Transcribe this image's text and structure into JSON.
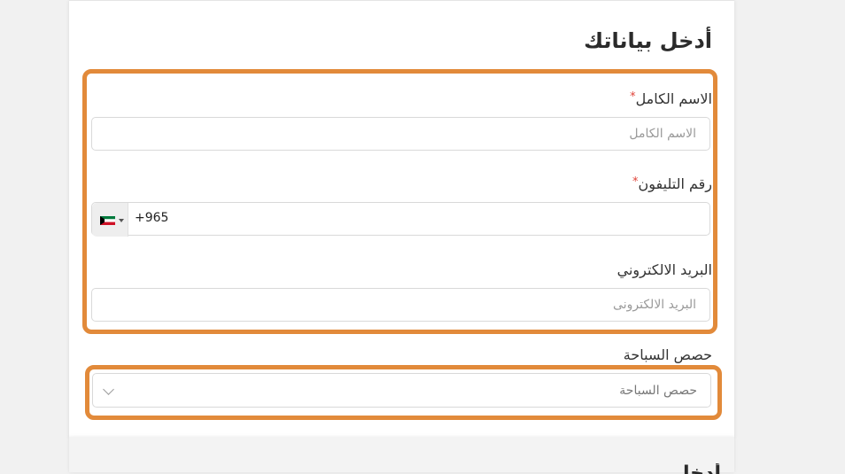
{
  "form": {
    "heading": "أدخل بياناتك",
    "next_heading_partial": "أدخل",
    "full_name": {
      "label": "الاسم الكامل",
      "required_mark": "*",
      "placeholder": "الاسم الكامل"
    },
    "phone": {
      "label": "رقم التليفون",
      "required_mark": "*",
      "dial_code": "+965",
      "country_icon": "kuwait-flag-icon"
    },
    "email": {
      "label": "البريد الالكتروني",
      "placeholder": "البريد الالكترونى"
    },
    "swimming": {
      "label": "حصص السباحة",
      "selected": "حصص السباحة"
    }
  },
  "colors": {
    "highlight": "#e28a3a",
    "required": "#e0443a",
    "flag_green": "#007a3d",
    "flag_red": "#ce1126"
  }
}
